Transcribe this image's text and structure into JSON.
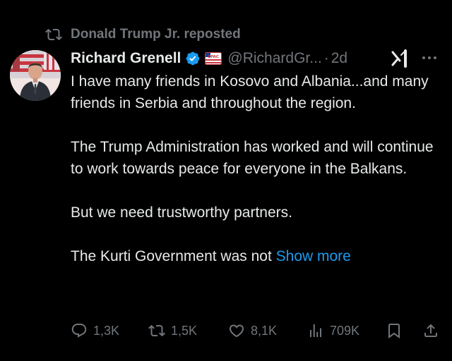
{
  "repost": {
    "icon": "repost-icon",
    "text": "Donald Trump Jr. reposted"
  },
  "author": {
    "avatar": "avatar",
    "name": "Richard Grenell",
    "verified_icon": "verified-badge-icon",
    "affiliation_icon": "cpac-affiliation-icon",
    "handle": "@RichardGr...",
    "separator": "·",
    "time": "2d"
  },
  "header_actions": {
    "grok_icon": "grok-icon",
    "more_icon": "more-icon"
  },
  "tweet": {
    "p1": "I have many friends in Kosovo and Albania...and many friends in Serbia and throughout the region.",
    "p2": "The Trump Administration has worked and will continue to work towards peace for everyone in the Balkans.",
    "p3": "But we need trustworthy partners.",
    "p4": "The Kurti Government was not ",
    "show_more": "Show more"
  },
  "actions": {
    "replies": "1,3K",
    "reposts": "1,5K",
    "likes": "8,1K",
    "views": "709K",
    "bookmark_icon": "bookmark-icon",
    "share_icon": "share-icon"
  },
  "colors": {
    "background": "#000000",
    "text": "#e7e9ea",
    "muted": "#71767b",
    "link": "#1d9bf0",
    "verified": "#1d9bf0"
  }
}
